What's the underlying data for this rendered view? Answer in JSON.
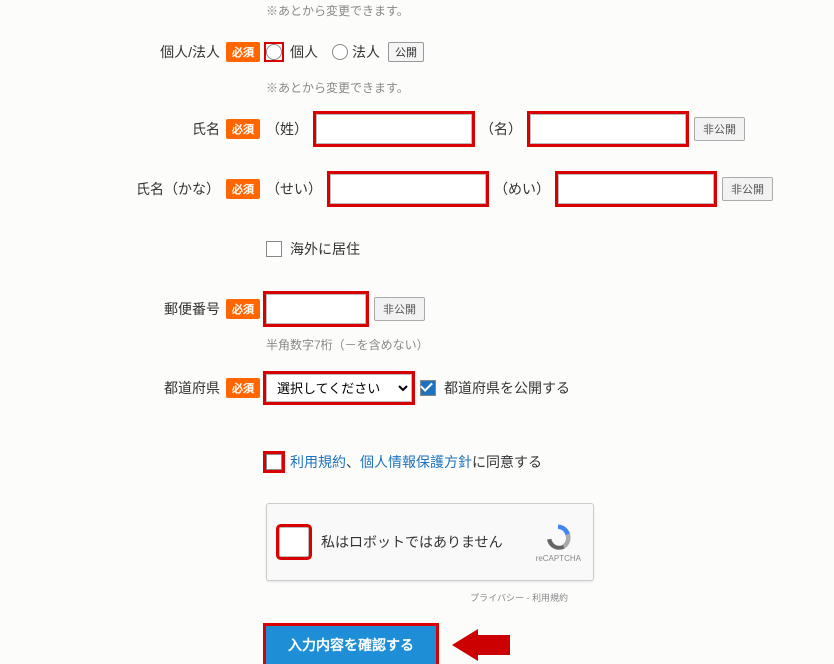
{
  "notes": {
    "change_later": "※あとから変更できます。",
    "postal_hint": "半角数字7桁（－を含めない）"
  },
  "labels": {
    "entity": "個人/法人",
    "name": "氏名",
    "name_kana": "氏名（かな）",
    "postal": "郵便番号",
    "prefecture": "都道府県"
  },
  "required": "必須",
  "entity": {
    "opt_personal": "個人",
    "opt_corp": "法人",
    "public": "公開"
  },
  "name": {
    "sei": "（姓）",
    "mei": "（名）",
    "private": "非公開"
  },
  "kana": {
    "sei": "（せい）",
    "mei": "（めい）",
    "private": "非公開"
  },
  "overseas": "海外に居住",
  "postal": {
    "private": "非公開"
  },
  "prefecture": {
    "placeholder": "選択してください",
    "publish": "都道府県を公開する"
  },
  "agree": {
    "link1": "利用規約",
    "sep": "、",
    "link2": "個人情報保護方針",
    "suffix": "に同意する"
  },
  "recaptcha": {
    "label": "私はロボットではありません",
    "brand": "reCAPTCHA",
    "privacy": "プライバシー",
    "terms": "利用規約",
    "dash": " - "
  },
  "submit": "入力内容を確認する"
}
